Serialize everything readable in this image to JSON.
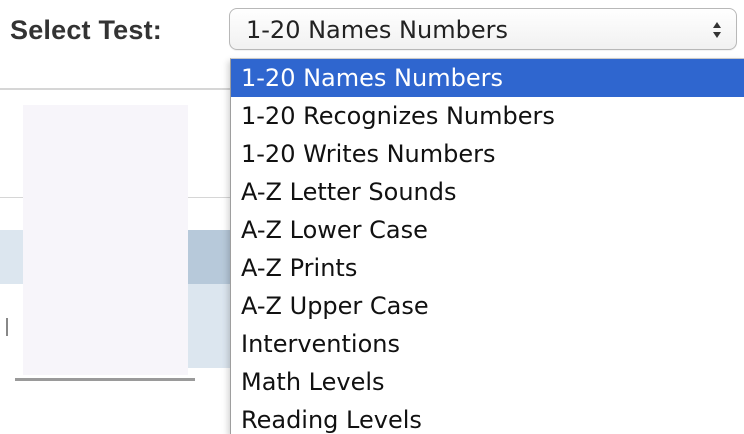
{
  "header": {
    "label": "Select Test:",
    "select_value": "1-20 Names Numbers",
    "arrows_icon": "up-down-arrows-icon"
  },
  "dropdown": {
    "selected_index": 0,
    "options": [
      {
        "label": "1-20 Names Numbers"
      },
      {
        "label": "1-20 Recognizes Numbers"
      },
      {
        "label": "1-20 Writes Numbers"
      },
      {
        "label": "A-Z Letter Sounds"
      },
      {
        "label": "A-Z Lower Case"
      },
      {
        "label": "A-Z Prints"
      },
      {
        "label": "A-Z Upper Case"
      },
      {
        "label": "Interventions"
      },
      {
        "label": "Math Levels"
      },
      {
        "label": "Reading Levels"
      }
    ]
  },
  "colors": {
    "selected_background": "#2f66cf",
    "selected_text": "#ffffff",
    "option_text": "#111111",
    "label_text": "#333333"
  }
}
